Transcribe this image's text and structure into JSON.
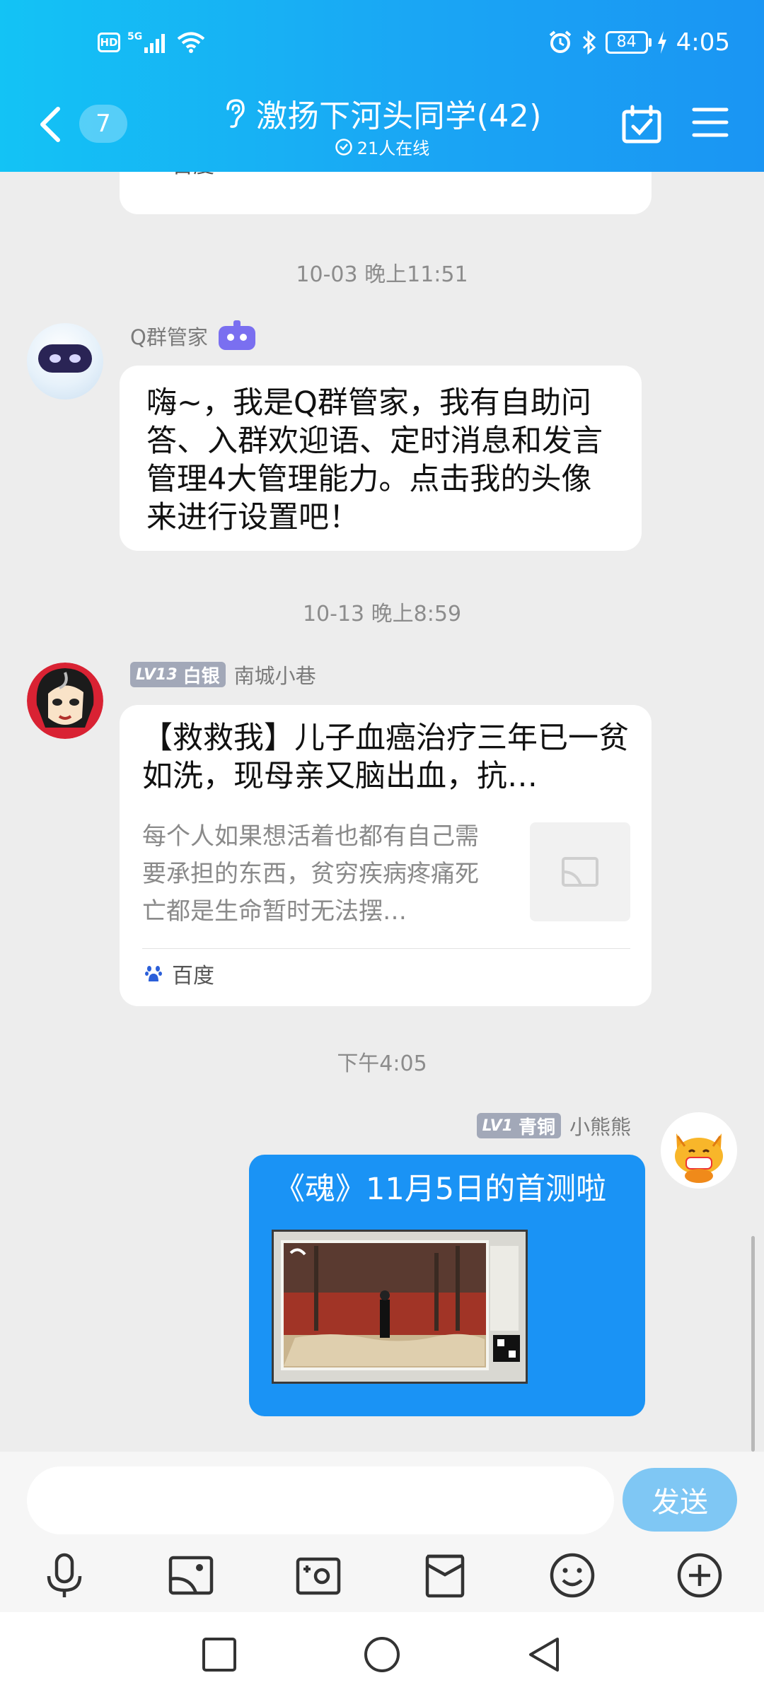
{
  "status_bar": {
    "hd": "HD",
    "network": "5G",
    "battery": "84",
    "time": "4:05"
  },
  "header": {
    "unread_count": "7",
    "group_title": "激扬下河头同学(42)",
    "online_count": "21人在线"
  },
  "messages": {
    "top_card_source": "百度",
    "ts1": "10-03 晚上11:51",
    "bot_name": "Q群管家",
    "bot_message": "嗨~，我是Q群管家，我有自助问答、入群欢迎语、定时消息和发言管理4大管理能力。点击我的头像来进行设置吧！",
    "ts2": "10-13 晚上8:59",
    "user2_level": "LV13",
    "user2_rank": "白银",
    "user2_name": "南城小巷",
    "share_title": "【救救我】儿子血癌治疗三年已一贫如洗，现母亲又脑出血，抗…",
    "share_desc": "每个人如果想活着也都有自己需要承担的东西，贫穷疾病疼痛死亡都是生命暂时无法摆…",
    "share_source": "百度",
    "ts3": "下午4:05",
    "self_level": "LV1",
    "self_rank": "青铜",
    "self_name": "小熊熊",
    "self_message": "《魂》11月5日的首测啦"
  },
  "input": {
    "placeholder": "",
    "send_label": "发送"
  },
  "colors": {
    "header_start": "#13c3f5",
    "header_end": "#1a95f3",
    "self_bubble": "#1a93f5",
    "send_button": "#7fc7f4",
    "badge": "#a2a8b8"
  },
  "icons": {
    "toolbar": [
      "microphone-icon",
      "image-icon",
      "camera-icon",
      "red-packet-icon",
      "emoji-icon",
      "plus-icon"
    ],
    "navbar": [
      "recent-apps-icon",
      "home-icon",
      "back-nav-icon"
    ]
  }
}
